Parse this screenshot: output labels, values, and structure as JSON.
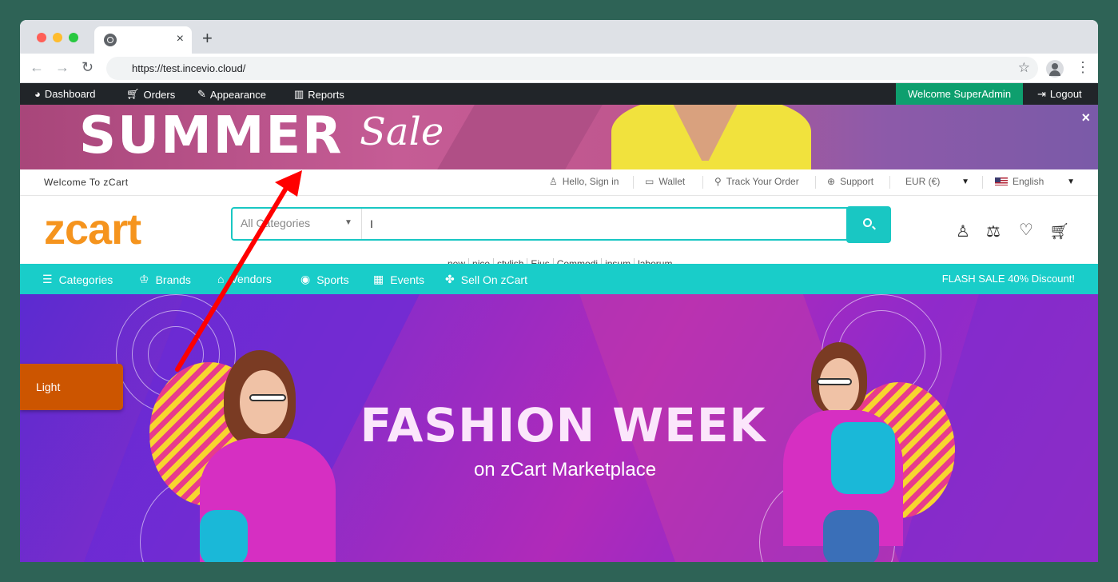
{
  "browser": {
    "url": "https://test.incevio.cloud/",
    "tab_close": "×",
    "new_tab": "+"
  },
  "adminbar": {
    "items": [
      "Dashboard",
      "Orders",
      "Appearance",
      "Reports"
    ],
    "welcome": "Welcome SuperAdmin",
    "logout": "Logout"
  },
  "promo": {
    "headline": "SUMMER",
    "script": "Sale",
    "close": "×"
  },
  "topbar": {
    "welcome": "Welcome To zCart",
    "sign_in": "Hello, Sign in",
    "wallet": "Wallet",
    "track": "Track Your Order",
    "support": "Support",
    "currency": "EUR (€)",
    "language": "English"
  },
  "header": {
    "logo": "zcart",
    "search": {
      "category": "All Categories",
      "query": "I"
    },
    "tags": [
      "new",
      "nice",
      "stylish",
      "Eius",
      "Commodi",
      "ipsum",
      "laborum"
    ]
  },
  "navbar": {
    "items": [
      "Categories",
      "Brands",
      "Vendors",
      "Sports",
      "Events",
      "Sell On zCart"
    ],
    "flash": "FLASH SALE 40% Discount!"
  },
  "hero": {
    "title": "FASHION WEEK",
    "subtitle": "on zCart Marketplace"
  },
  "theme_toggle": "Light",
  "colors": {
    "accent": "#19cdc9",
    "brand": "#f5941e",
    "admin_welcome": "#0e9f6e",
    "theme_toggle": "#cc5500",
    "annotation_arrow": "#ff0000"
  }
}
